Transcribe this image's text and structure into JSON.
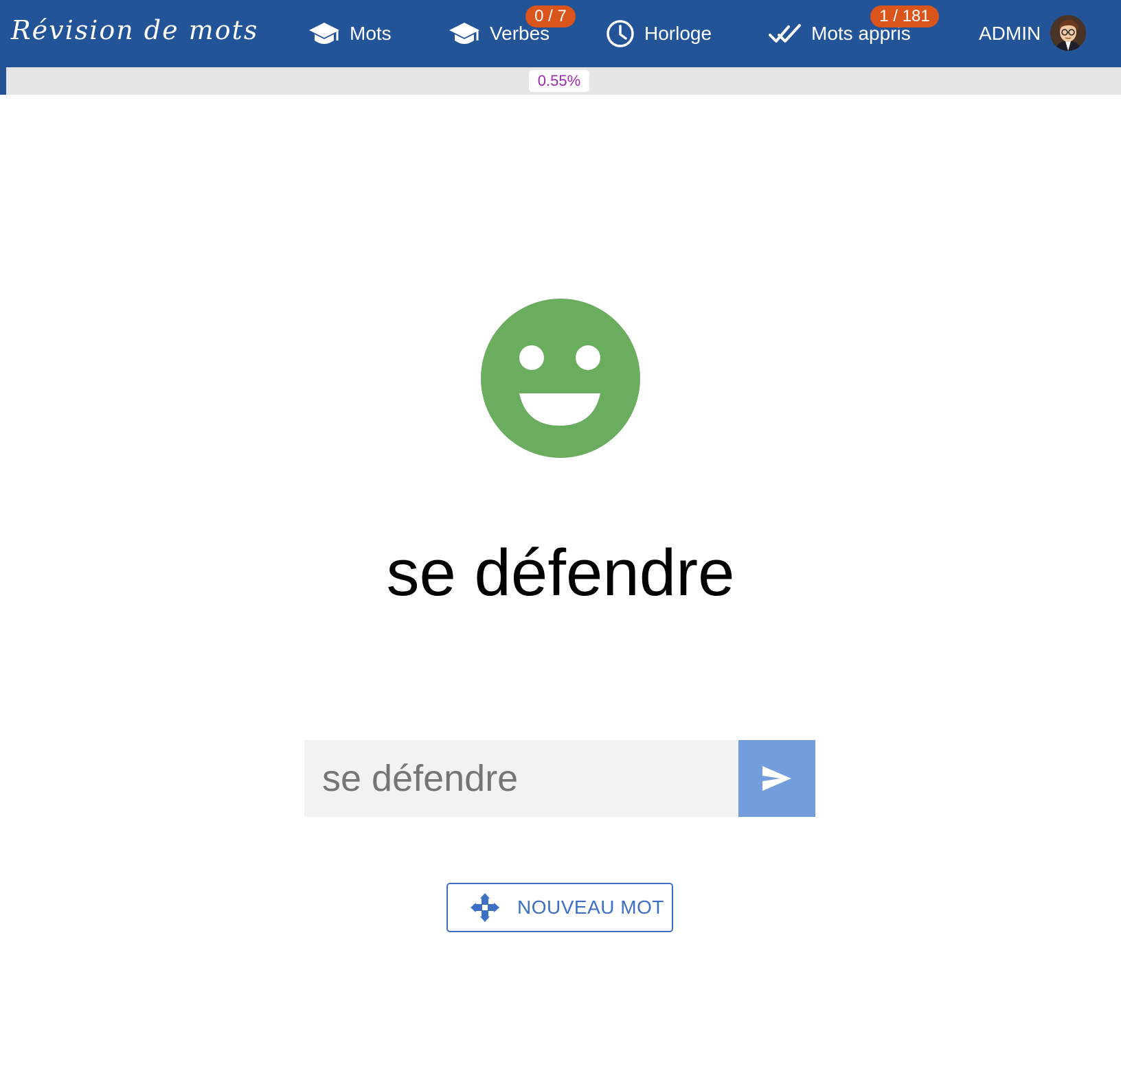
{
  "app": {
    "brand": "Révision de mots"
  },
  "nav": {
    "items": [
      {
        "label": "Mots",
        "icon": "graduation-cap-icon"
      },
      {
        "label": "Verbes",
        "icon": "graduation-cap-icon",
        "badge": "0 / 7"
      },
      {
        "label": "Horloge",
        "icon": "clock-icon"
      },
      {
        "label": "Mots appris",
        "icon": "double-check-icon",
        "badge": "1 / 181"
      }
    ],
    "user": {
      "label": "ADMIN",
      "avatar_icon": "user-avatar"
    },
    "badge_color": "#d9551b",
    "bar_color": "#235497"
  },
  "progress": {
    "percent": 0.55,
    "label": "0.55%"
  },
  "quiz": {
    "feedback_icon": "smiley-happy-icon",
    "feedback_color": "#6aad5e",
    "word": "se défendre",
    "answer_value": "se défendre",
    "send_icon": "send-icon",
    "send_color": "#739ddb",
    "new_word_label": "NOUVEAU MOT",
    "new_word_icon": "move-arrows-icon",
    "accent_color": "#3d6fc4"
  }
}
